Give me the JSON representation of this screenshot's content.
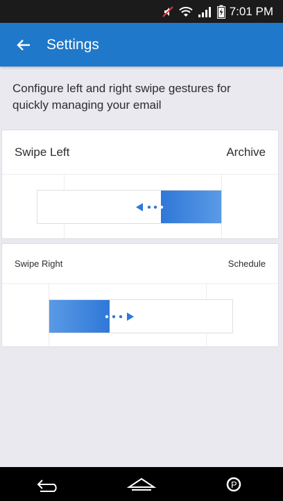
{
  "status_bar": {
    "time": "7:01 PM",
    "icons": [
      "muted-icon",
      "wifi-icon",
      "signal-icon",
      "battery-charging-icon"
    ]
  },
  "app_bar": {
    "title": "Settings",
    "back_icon": "arrow-left-icon"
  },
  "description": "Configure left and right swipe gestures for quickly managing your email",
  "swipe_left": {
    "label": "Swipe Left",
    "value": "Archive"
  },
  "swipe_right": {
    "label": "Swipe Right",
    "value": "Schedule"
  },
  "colors": {
    "primary": "#1f78c9",
    "swipe_fill_start": "#2f78d8",
    "swipe_fill_end": "#5a9ae6",
    "background": "#e9e9ef"
  },
  "nav_bar": {
    "icons": [
      "back-icon",
      "home-icon",
      "overview-icon"
    ]
  }
}
